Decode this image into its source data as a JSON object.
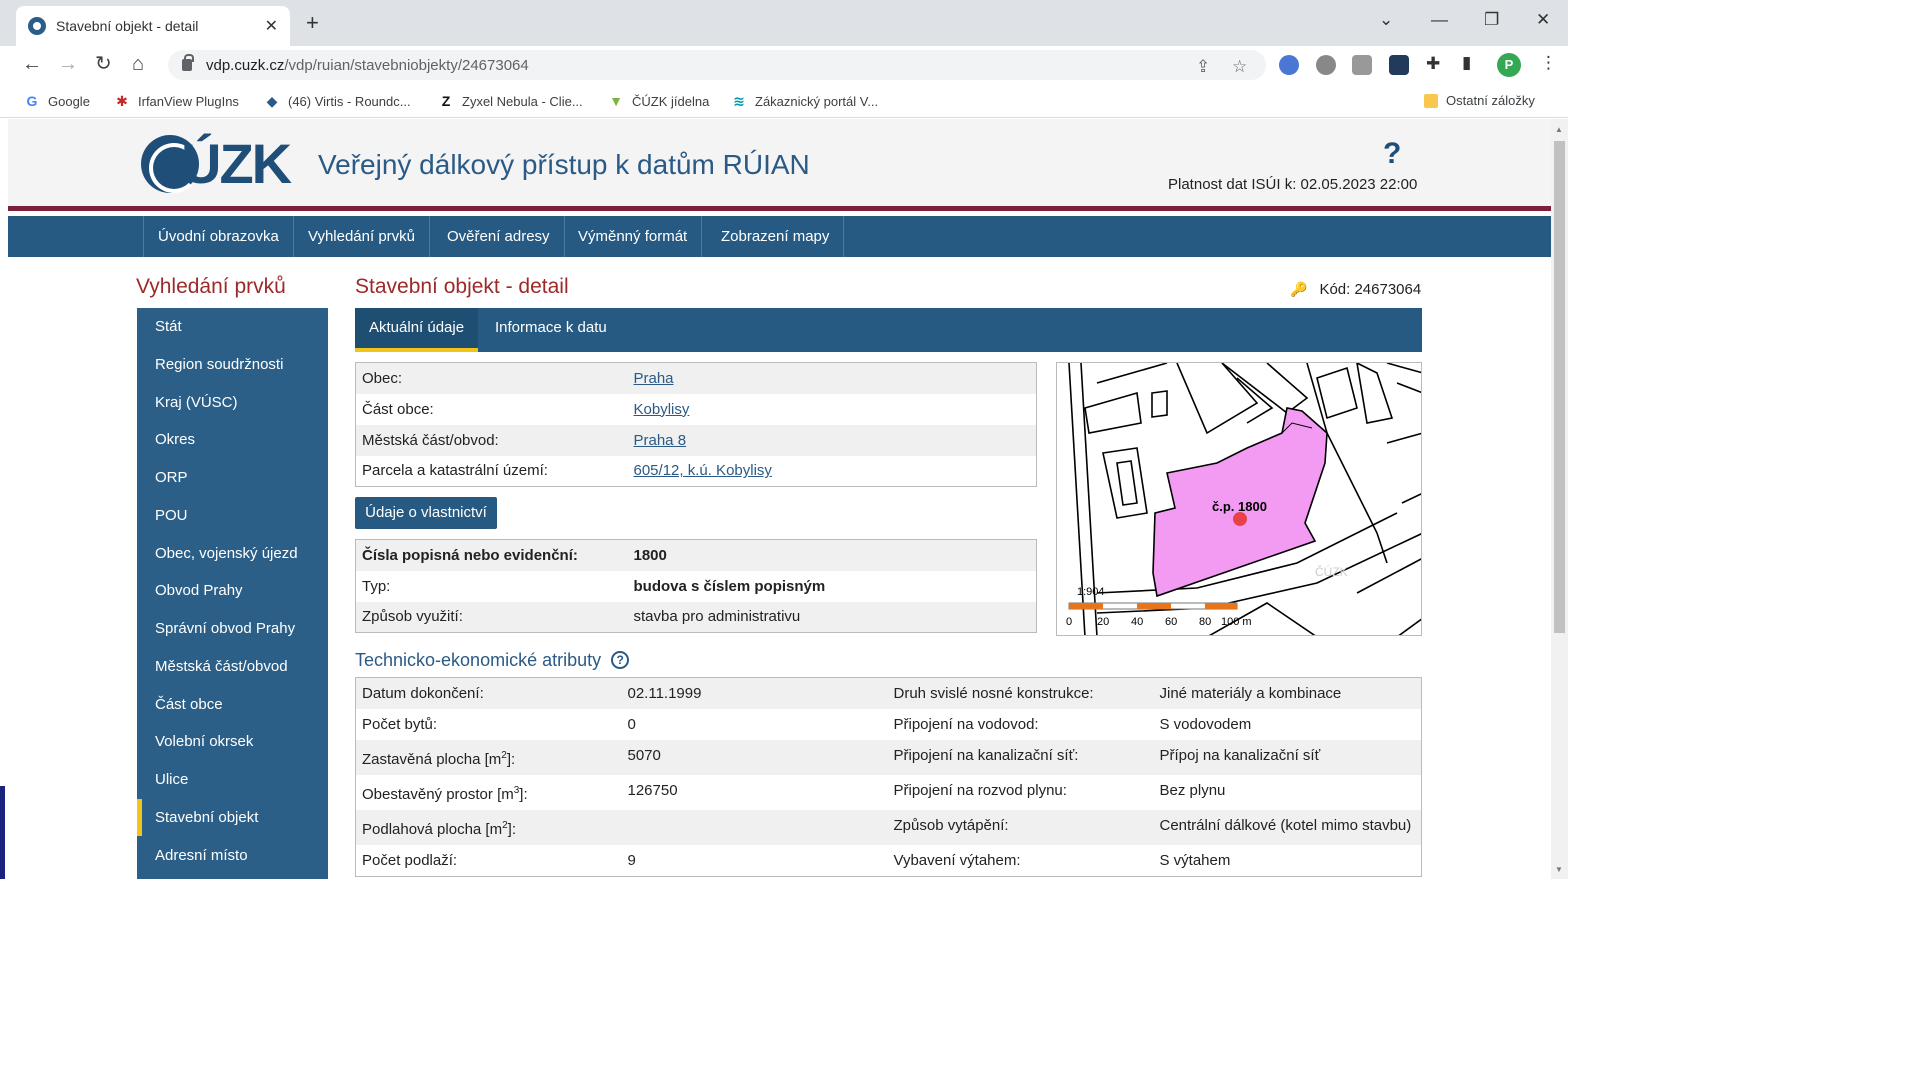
{
  "browser": {
    "tab_title": "Stavební objekt - detail",
    "url_host": "vdp.cuzk.cz",
    "url_path": "/vdp/ruian/stavebniobjekty/24673064",
    "bookmarks": [
      {
        "label": "Google"
      },
      {
        "label": "IrfanView PlugIns"
      },
      {
        "label": "(46) Virtis - Roundc..."
      },
      {
        "label": "Zyxel Nebula - Clie..."
      },
      {
        "label": "ČÚZK jídelna"
      },
      {
        "label": "Zákaznický portál V..."
      }
    ],
    "other_bookmarks": "Ostatní záložky",
    "profile_initial": "P"
  },
  "header": {
    "logo_text": "ÚZK",
    "app_title": "Veřejný dálkový přístup k datům RÚIAN",
    "help": "?",
    "validity": "Platnost dat ISÚI k: 02.05.2023 22:00"
  },
  "nav": [
    "Úvodní obrazovka",
    "Vyhledání prvků",
    "Ověření adresy",
    "Výměnný formát",
    "Zobrazení mapy"
  ],
  "sidebar": {
    "title": "Vyhledání prvků",
    "items": [
      "Stát",
      "Region soudržnosti",
      "Kraj (VÚSC)",
      "Okres",
      "ORP",
      "POU",
      "Obec, vojenský újezd",
      "Obvod Prahy",
      "Správní obvod Prahy",
      "Městská část/obvod",
      "Část obce",
      "Volební okrsek",
      "Ulice",
      "Stavební objekt",
      "Adresní místo"
    ],
    "active": "Stavební objekt"
  },
  "main": {
    "title": "Stavební objekt - detail",
    "code": "Kód: 24673064",
    "tabs": [
      "Aktuální údaje",
      "Informace k datu"
    ],
    "location_rows": [
      {
        "label": "Obec:",
        "value": "Praha"
      },
      {
        "label": "Část obce:",
        "value": "Kobylisy"
      },
      {
        "label": "Městská část/obvod:",
        "value": "Praha 8"
      },
      {
        "label": "Parcela a katastrální území:",
        "value": "605/12, k.ú. Kobylisy"
      }
    ],
    "owner_button": "Údaje o vlastnictví",
    "building_rows": [
      {
        "label": "Čísla popisná nebo evidenční:",
        "value": "1800"
      },
      {
        "label": "Typ:",
        "value": "budova s číslem popisným"
      },
      {
        "label": "Způsob využití:",
        "value": "stavba pro administrativu"
      }
    ],
    "map": {
      "building_label": "č.p. 1800",
      "scale_text": "1:904",
      "scale_ticks": [
        "0",
        "20",
        "40",
        "60",
        "80",
        "100 m"
      ],
      "watermark": "ČÚZK"
    },
    "section_title": "Technicko-ekonomické atributy",
    "section_help": "?",
    "attributes": [
      {
        "l1": "Datum dokončení:",
        "v1": "02.11.1999",
        "l2": "Druh svislé nosné konstrukce:",
        "v2": "Jiné materiály a kombinace"
      },
      {
        "l1": "Počet bytů:",
        "v1": "0",
        "l2": "Připojení na vodovod:",
        "v2": "S vodovodem"
      },
      {
        "l1": "Zastavěná plocha [m",
        "l1sup": "2",
        "l1end": "]:",
        "v1": "5070",
        "l2": "Připojení na kanalizační síť:",
        "v2": "Přípoj na kanalizační síť"
      },
      {
        "l1": "Obestavěný prostor [m",
        "l1sup": "3",
        "l1end": "]:",
        "v1": "126750",
        "l2": "Připojení na rozvod plynu:",
        "v2": "Bez plynu"
      },
      {
        "l1": "Podlahová plocha [m",
        "l1sup": "2",
        "l1end": "]:",
        "v1": "",
        "l2": "Způsob vytápění:",
        "v2": "Centrální dálkové (kotel mimo stavbu)"
      },
      {
        "l1": "Počet podlaží:",
        "v1": "9",
        "l2": "Vybavení výtahem:",
        "v2": "S výtahem"
      }
    ]
  }
}
